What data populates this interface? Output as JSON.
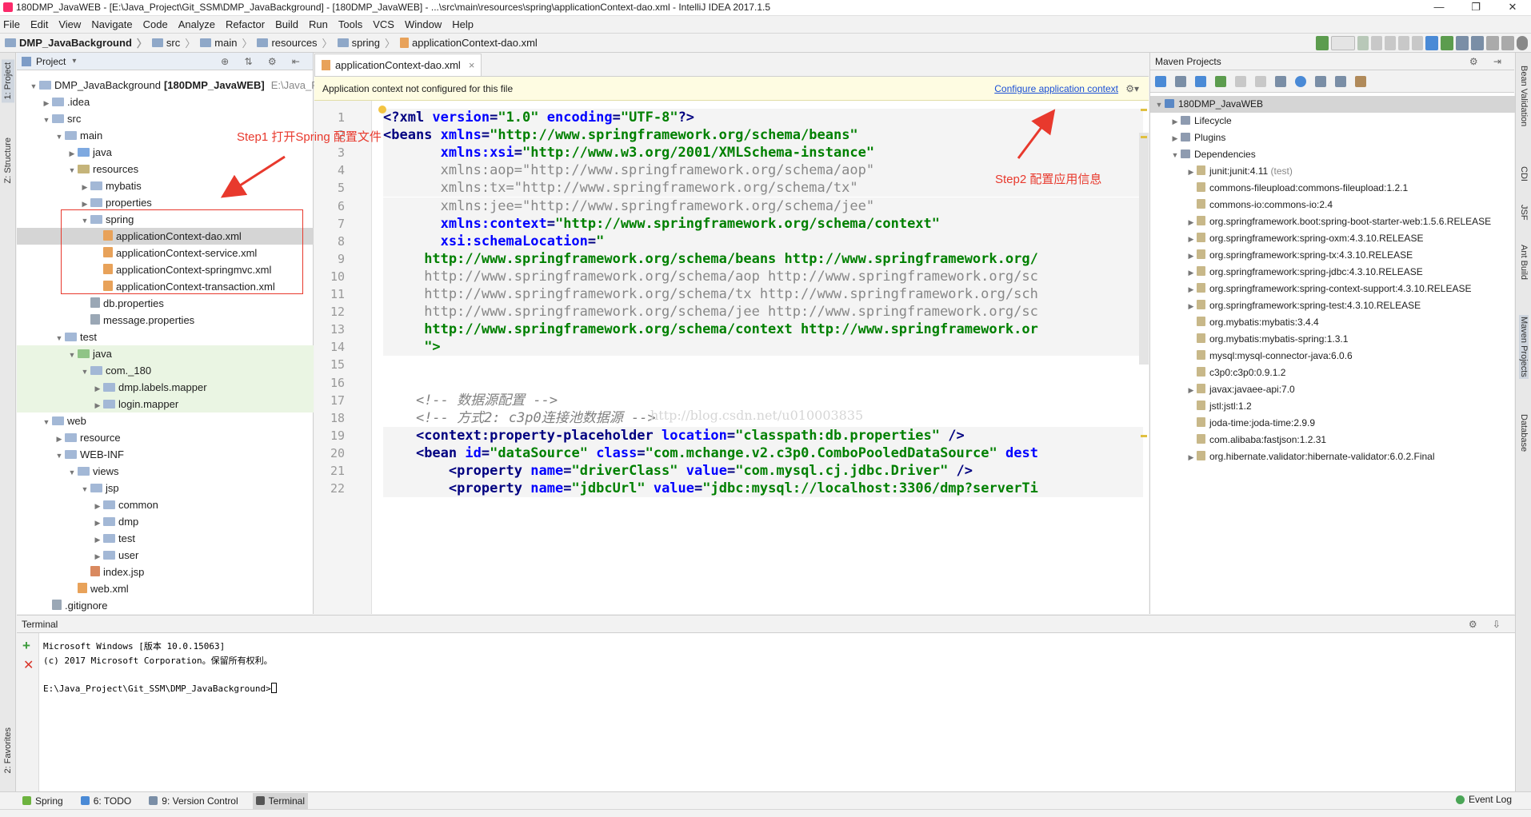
{
  "window": {
    "title": "180DMP_JavaWEB - [E:\\Java_Project\\Git_SSM\\DMP_JavaBackground] - [180DMP_JavaWEB] - ...\\src\\main\\resources\\spring\\applicationContext-dao.xml - IntelliJ IDEA 2017.1.5",
    "controls": [
      "—",
      "❐",
      "✕"
    ]
  },
  "menu": [
    "File",
    "Edit",
    "View",
    "Navigate",
    "Code",
    "Analyze",
    "Refactor",
    "Build",
    "Run",
    "Tools",
    "VCS",
    "Window",
    "Help"
  ],
  "breadcrumbs": [
    "DMP_JavaBackground",
    "src",
    "main",
    "resources",
    "spring",
    "applicationContext-dao.xml"
  ],
  "left_stripe": {
    "project": "1: Project",
    "structure": "Z: Structure",
    "favorites": "2: Favorites"
  },
  "right_stripe": [
    "Bean Validation",
    "CDI",
    "JSF",
    "Ant Build",
    "Maven Projects",
    "Database"
  ],
  "project_panel": {
    "title": "Project",
    "tree": [
      {
        "label": "DMP_JavaBackground",
        "bold_suffix": "[180DMP_JavaWEB]",
        "extra": "E:\\Java_Proj",
        "depth": 0,
        "arrow": "▼",
        "icon": "folder"
      },
      {
        "label": ".idea",
        "depth": 1,
        "arrow": "▶",
        "icon": "folder"
      },
      {
        "label": "src",
        "depth": 1,
        "arrow": "▼",
        "icon": "folder"
      },
      {
        "label": "main",
        "depth": 2,
        "arrow": "▼",
        "icon": "folder"
      },
      {
        "label": "java",
        "depth": 3,
        "arrow": "▶",
        "icon": "src"
      },
      {
        "label": "resources",
        "depth": 3,
        "arrow": "▼",
        "icon": "res"
      },
      {
        "label": "mybatis",
        "depth": 4,
        "arrow": "▶",
        "icon": "folder"
      },
      {
        "label": "properties",
        "depth": 4,
        "arrow": "▶",
        "icon": "folder"
      },
      {
        "label": "spring",
        "depth": 4,
        "arrow": "▼",
        "icon": "folder"
      },
      {
        "label": "applicationContext-dao.xml",
        "depth": 5,
        "arrow": "",
        "icon": "xml",
        "selected": true
      },
      {
        "label": "applicationContext-service.xml",
        "depth": 5,
        "arrow": "",
        "icon": "xml"
      },
      {
        "label": "applicationContext-springmvc.xml",
        "depth": 5,
        "arrow": "",
        "icon": "xml"
      },
      {
        "label": "applicationContext-transaction.xml",
        "depth": 5,
        "arrow": "",
        "icon": "xml"
      },
      {
        "label": "db.properties",
        "depth": 4,
        "arrow": "",
        "icon": "prop"
      },
      {
        "label": "message.properties",
        "depth": 4,
        "arrow": "",
        "icon": "prop"
      },
      {
        "label": "test",
        "depth": 2,
        "arrow": "▼",
        "icon": "folder"
      },
      {
        "label": "java",
        "depth": 3,
        "arrow": "▼",
        "icon": "test",
        "green": true
      },
      {
        "label": "com._180",
        "depth": 4,
        "arrow": "▼",
        "icon": "folder",
        "green": true
      },
      {
        "label": "dmp.labels.mapper",
        "depth": 5,
        "arrow": "▶",
        "icon": "folder",
        "green": true
      },
      {
        "label": "login.mapper",
        "depth": 5,
        "arrow": "▶",
        "icon": "folder",
        "green": true
      },
      {
        "label": "web",
        "depth": 1,
        "arrow": "▼",
        "icon": "folder"
      },
      {
        "label": "resource",
        "depth": 2,
        "arrow": "▶",
        "icon": "folder"
      },
      {
        "label": "WEB-INF",
        "depth": 2,
        "arrow": "▼",
        "icon": "folder"
      },
      {
        "label": "views",
        "depth": 3,
        "arrow": "▼",
        "icon": "folder"
      },
      {
        "label": "jsp",
        "depth": 4,
        "arrow": "▼",
        "icon": "folder"
      },
      {
        "label": "common",
        "depth": 5,
        "arrow": "▶",
        "icon": "folder"
      },
      {
        "label": "dmp",
        "depth": 5,
        "arrow": "▶",
        "icon": "folder"
      },
      {
        "label": "test",
        "depth": 5,
        "arrow": "▶",
        "icon": "folder"
      },
      {
        "label": "user",
        "depth": 5,
        "arrow": "▶",
        "icon": "folder"
      },
      {
        "label": "index.jsp",
        "depth": 4,
        "arrow": "",
        "icon": "jsp"
      },
      {
        "label": "web.xml",
        "depth": 3,
        "arrow": "",
        "icon": "xml"
      },
      {
        "label": ".gitignore",
        "depth": 1,
        "arrow": "",
        "icon": "prop"
      }
    ]
  },
  "annotations": {
    "step1": "Step1 打开Spring 配置文件",
    "step2": "Step2 配置应用信息",
    "watermark": "http://blog.csdn.net/u010003835"
  },
  "editor": {
    "tab_label": "applicationContext-dao.xml",
    "tab_close": "×",
    "notice": "Application context not configured for this file",
    "notice_link": "Configure application context",
    "lines": [
      {
        "n": "1",
        "html": "<span class='kw'>&lt;?xml </span><span class='at'>version</span><span class='kw'>=</span><span class='st'>\"1.0\"</span><span class='kw'> </span><span class='at'>encoding</span><span class='kw'>=</span><span class='st'>\"UTF-8\"</span><span class='kw'>?&gt;</span>",
        "hl": true
      },
      {
        "n": "2",
        "html": "<span class='kw'>&lt;beans </span><span class='at'>xmlns</span><span class='kw'>=</span><span class='st'>\"http://www.springframework.org/schema/beans\"</span>",
        "hl": true
      },
      {
        "n": "3",
        "html": "       <span class='at'>xmlns:xsi</span><span class='kw'>=</span><span class='st'>\"http://www.w3.org/2001/XMLSchema-instance\"</span>",
        "hl": true
      },
      {
        "n": "4",
        "html": "       <span class='gray'>xmlns:aop=\"http://www.springframework.org/schema/aop\"</span>",
        "hl": true
      },
      {
        "n": "5",
        "html": "       <span class='gray'>xmlns:tx=\"http://www.springframework.org/schema/tx\"</span>",
        "hl": true
      },
      {
        "n": "6",
        "html": "       <span class='gray'>xmlns:jee=\"http://www.springframework.org/schema/jee\"</span>",
        "hl": true
      },
      {
        "n": "7",
        "html": "       <span class='at'>xmlns:context</span><span class='kw'>=</span><span class='st'>\"http://www.springframework.org/schema/context\"</span>",
        "hl": true
      },
      {
        "n": "8",
        "html": "       <span class='at'>xsi:schemaLocation</span><span class='kw'>=</span><span class='st'>\"</span>",
        "hl": true
      },
      {
        "n": "9",
        "html": "     <span class='st'>http://www.springframework.org/schema/beans http://www.springframework.org/</span>",
        "hl": true
      },
      {
        "n": "10",
        "html": "     <span class='gray'>http://www.springframework.org/schema/aop http://www.springframework.org/sc</span>",
        "hl": true
      },
      {
        "n": "11",
        "html": "     <span class='gray'>http://www.springframework.org/schema/tx http://www.springframework.org/sch</span>",
        "hl": true
      },
      {
        "n": "12",
        "html": "     <span class='gray'>http://www.springframework.org/schema/jee http://www.springframework.org/sc</span>",
        "hl": true
      },
      {
        "n": "13",
        "html": "     <span class='st'>http://www.springframework.org/schema/context http://www.springframework.or</span>",
        "hl": true
      },
      {
        "n": "14",
        "html": "     <span class='st'>\"&gt;</span>",
        "hl": true
      },
      {
        "n": "15",
        "html": "",
        "hl": false
      },
      {
        "n": "16",
        "html": "",
        "hl": false
      },
      {
        "n": "17",
        "html": "    <span class='cm'>&lt;!-- 数据源配置 --&gt;</span>",
        "hl": false
      },
      {
        "n": "18",
        "html": "    <span class='cm'>&lt;!-- 方式2: c3p0连接池数据源 --&gt;</span>",
        "hl": false
      },
      {
        "n": "19",
        "html": "    <span class='kw'>&lt;context:property-placeholder </span><span class='at'>location</span><span class='kw'>=</span><span class='st'>\"classpath:db.properties\"</span><span class='kw'> /&gt;</span>",
        "hl": true
      },
      {
        "n": "20",
        "html": "    <span class='kw'>&lt;bean </span><span class='at'>id</span><span class='kw'>=</span><span class='st'>\"dataSource\"</span><span class='kw'> </span><span class='at'>class</span><span class='kw'>=</span><span class='st'>\"com.mchange.v2.c3p0.ComboPooledDataSource\"</span><span class='kw'> </span><span class='at'>dest</span>",
        "hl": true
      },
      {
        "n": "21",
        "html": "        <span class='kw'>&lt;property </span><span class='at'>name</span><span class='kw'>=</span><span class='st'>\"driverClass\"</span><span class='kw'> </span><span class='at'>value</span><span class='kw'>=</span><span class='st'>\"com.mysql.cj.jdbc.Driver\"</span><span class='kw'> /&gt;</span>",
        "hl": true
      },
      {
        "n": "22",
        "html": "        <span class='kw'>&lt;property </span><span class='at'>name</span><span class='kw'>=</span><span class='st'>\"jdbcUrl\"</span><span class='kw'> </span><span class='at'>value</span><span class='kw'>=</span><span class='st'>\"jdbc:mysql://localhost:3306/dmp?serverTi</span>",
        "hl": true
      }
    ]
  },
  "maven_panel": {
    "title": "Maven Projects",
    "tree": [
      {
        "label": "180DMP_JavaWEB",
        "depth": 0,
        "arrow": "▼",
        "icon": "m",
        "selected": true
      },
      {
        "label": "Lifecycle",
        "depth": 1,
        "arrow": "▶",
        "icon": "dep"
      },
      {
        "label": "Plugins",
        "depth": 1,
        "arrow": "▶",
        "icon": "dep"
      },
      {
        "label": "Dependencies",
        "depth": 1,
        "arrow": "▼",
        "icon": "dep"
      },
      {
        "label": "junit:junit:4.11",
        "scope": "(test)",
        "depth": 2,
        "arrow": "▶",
        "icon": "jar"
      },
      {
        "label": "commons-fileupload:commons-fileupload:1.2.1",
        "depth": 2,
        "arrow": "",
        "icon": "jar"
      },
      {
        "label": "commons-io:commons-io:2.4",
        "depth": 2,
        "arrow": "",
        "icon": "jar"
      },
      {
        "label": "org.springframework.boot:spring-boot-starter-web:1.5.6.RELEASE",
        "depth": 2,
        "arrow": "▶",
        "icon": "jar"
      },
      {
        "label": "org.springframework:spring-oxm:4.3.10.RELEASE",
        "depth": 2,
        "arrow": "▶",
        "icon": "jar"
      },
      {
        "label": "org.springframework:spring-tx:4.3.10.RELEASE",
        "depth": 2,
        "arrow": "▶",
        "icon": "jar"
      },
      {
        "label": "org.springframework:spring-jdbc:4.3.10.RELEASE",
        "depth": 2,
        "arrow": "▶",
        "icon": "jar"
      },
      {
        "label": "org.springframework:spring-context-support:4.3.10.RELEASE",
        "depth": 2,
        "arrow": "▶",
        "icon": "jar"
      },
      {
        "label": "org.springframework:spring-test:4.3.10.RELEASE",
        "depth": 2,
        "arrow": "▶",
        "icon": "jar"
      },
      {
        "label": "org.mybatis:mybatis:3.4.4",
        "depth": 2,
        "arrow": "",
        "icon": "jar"
      },
      {
        "label": "org.mybatis:mybatis-spring:1.3.1",
        "depth": 2,
        "arrow": "",
        "icon": "jar"
      },
      {
        "label": "mysql:mysql-connector-java:6.0.6",
        "depth": 2,
        "arrow": "",
        "icon": "jar"
      },
      {
        "label": "c3p0:c3p0:0.9.1.2",
        "depth": 2,
        "arrow": "",
        "icon": "jar"
      },
      {
        "label": "javax:javaee-api:7.0",
        "depth": 2,
        "arrow": "▶",
        "icon": "jar"
      },
      {
        "label": "jstl:jstl:1.2",
        "depth": 2,
        "arrow": "",
        "icon": "jar"
      },
      {
        "label": "joda-time:joda-time:2.9.9",
        "depth": 2,
        "arrow": "",
        "icon": "jar"
      },
      {
        "label": "com.alibaba:fastjson:1.2.31",
        "depth": 2,
        "arrow": "",
        "icon": "jar"
      },
      {
        "label": "org.hibernate.validator:hibernate-validator:6.0.2.Final",
        "depth": 2,
        "arrow": "▶",
        "icon": "jar"
      }
    ]
  },
  "terminal": {
    "title": "Terminal",
    "lines": [
      "Microsoft Windows [版本 10.0.15063]",
      "(c) 2017 Microsoft Corporation。保留所有权利。",
      "",
      "E:\\Java_Project\\Git_SSM\\DMP_JavaBackground>"
    ]
  },
  "bottom_tabs": [
    {
      "label": "Spring",
      "color": "#6db33f"
    },
    {
      "label": "6: TODO",
      "color": "#4a8ad6"
    },
    {
      "label": "9: Version Control",
      "color": "#7a8ea6"
    },
    {
      "label": "Terminal",
      "color": "#555555",
      "active": true
    }
  ],
  "event_log": "Event Log",
  "colors": {
    "annotation": "#e8392d",
    "link": "#1a4fd6"
  }
}
